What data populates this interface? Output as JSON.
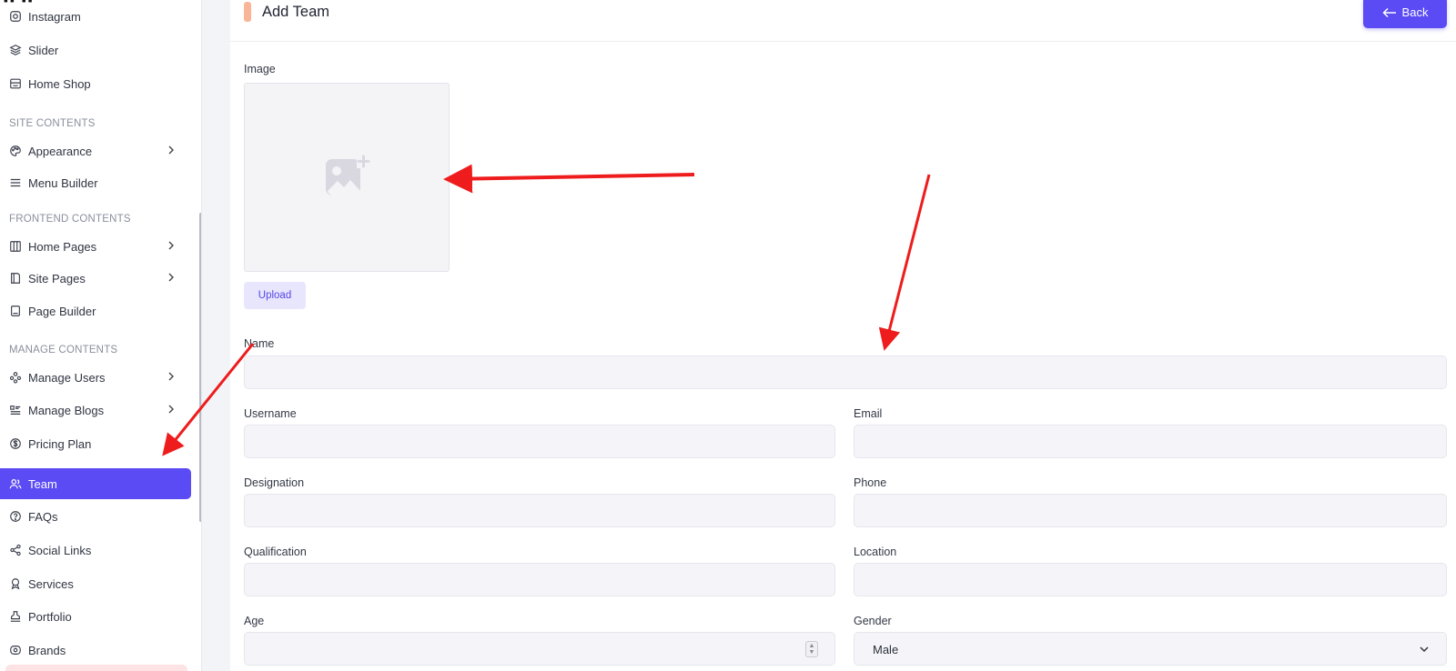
{
  "sidebar": {
    "items": [
      {
        "label": "Instagram",
        "icon": "instagram-icon"
      },
      {
        "label": "Slider",
        "icon": "layers-icon"
      },
      {
        "label": "Home Shop",
        "icon": "shop-icon"
      },
      {
        "label": "Appearance",
        "icon": "palette-icon"
      },
      {
        "label": "Menu Builder",
        "icon": "menu-icon"
      },
      {
        "label": "Home Pages",
        "icon": "columns-icon"
      },
      {
        "label": "Site Pages",
        "icon": "book-icon"
      },
      {
        "label": "Page Builder",
        "icon": "notebook-icon"
      },
      {
        "label": "Manage Users",
        "icon": "users-icon"
      },
      {
        "label": "Manage Blogs",
        "icon": "list-icon"
      },
      {
        "label": "Pricing Plan",
        "icon": "dollar-icon"
      },
      {
        "label": "Team",
        "icon": "team-icon"
      },
      {
        "label": "FAQs",
        "icon": "question-icon"
      },
      {
        "label": "Social Links",
        "icon": "share-icon"
      },
      {
        "label": "Services",
        "icon": "badge-icon"
      },
      {
        "label": "Portfolio",
        "icon": "stamp-icon"
      },
      {
        "label": "Brands",
        "icon": "brand-icon"
      }
    ],
    "sections": {
      "site": "SITE CONTENTS",
      "frontend": "FRONTEND CONTENTS",
      "manage": "MANAGE CONTENTS"
    },
    "active": "Team",
    "accent": "#5b4bf5"
  },
  "header": {
    "title": "Add Team",
    "back_label": "Back"
  },
  "form": {
    "image_label": "Image",
    "upload_label": "Upload",
    "name_label": "Name",
    "username_label": "Username",
    "email_label": "Email",
    "designation_label": "Designation",
    "phone_label": "Phone",
    "qualification_label": "Qualification",
    "location_label": "Location",
    "age_label": "Age",
    "gender_label": "Gender",
    "gender_value": "Male"
  }
}
